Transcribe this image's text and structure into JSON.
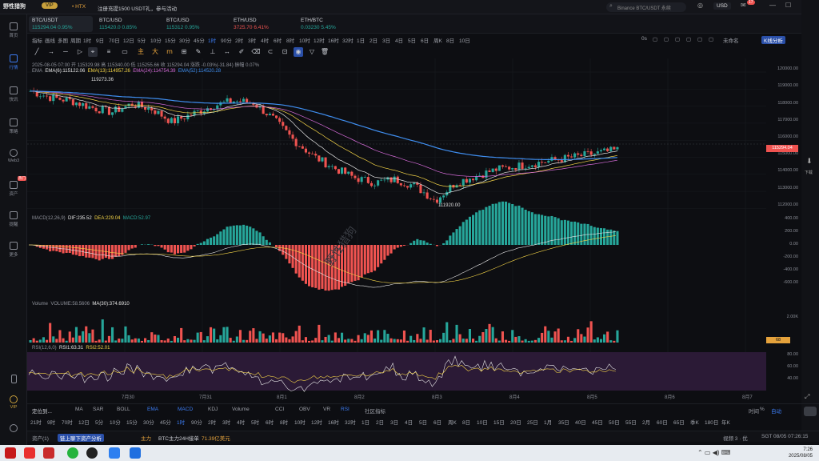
{
  "app": {
    "logo_text": "野性猎狗",
    "vip": "VIP",
    "exchange_tag": "• HTX",
    "promo": "注册充提1500 USDT礼，参与活动",
    "search_placeholder": "Binance BTC/USDT 永续",
    "currency": "USD",
    "notif_count": "17"
  },
  "sidebar": {
    "items": [
      {
        "label": "首页"
      },
      {
        "label": "行情"
      },
      {
        "label": "快讯"
      },
      {
        "label": "策略"
      },
      {
        "label": "Web3"
      },
      {
        "label": "资产"
      },
      {
        "label": "提醒"
      },
      {
        "label": "更多"
      }
    ],
    "bottom_vip": "VIP",
    "badge": "热门"
  },
  "tickers": [
    {
      "name": "BTC/USDT",
      "price": "115294.04",
      "change": "0.95%",
      "dir": "up"
    },
    {
      "name": "BTC/USD",
      "price": "115420.0",
      "change": "0.85%",
      "dir": "up"
    },
    {
      "name": "BTC/USD",
      "price": "115312",
      "change": "0.95%",
      "dir": "up"
    },
    {
      "name": "ETH/USD",
      "price": "3725.70",
      "change": "6.41%",
      "dir": "dn"
    },
    {
      "name": "ETH/BTC",
      "price": "0.03230",
      "change": "5.45%",
      "dir": "up"
    }
  ],
  "intervals": [
    "指标",
    "画线",
    "多图",
    "周期",
    "1时",
    "9日",
    "70日",
    "12日",
    "5分",
    "10分",
    "15分",
    "30分",
    "45分",
    "1时",
    "90分",
    "2时",
    "3时",
    "4时",
    "6时",
    "8时",
    "10时",
    "12时",
    "16时",
    "32时",
    "1日",
    "2日",
    "3日",
    "4日",
    "5日",
    "6日",
    "周K",
    "8日",
    "10日"
  ],
  "interval_right": [
    "0s",
    "未命名",
    "K线分析"
  ],
  "ohlc_line": "2025-08-05 07:00  开 115329.98  高 115340.00  低 115255.66  收 115294.04  涨跌 -0.03%(-31.84)  振幅 0.07%",
  "ema_line": {
    "label": "EMA",
    "ema6": "EMA(6):115122.06",
    "ema13": "EMA(13):114957.26",
    "ema24": "EMA(24):114754.39",
    "ema52": "EMA(52):114520.28"
  },
  "macd_line": {
    "label": "MACD(12,26,9)",
    "dif": "DIF:235.52",
    "dea": "DEA:229.04",
    "macd": "MACD:52.97"
  },
  "volume_line": {
    "label": "Volume",
    "vol": "VOLUME:58.5606",
    "ma": "MA(30):374.6910"
  },
  "rsi_line": {
    "label": "RSI(12,6,0)",
    "rsi1": "RSI1:63.31",
    "rsi2": "RSI2:52.01"
  },
  "annotations": {
    "high": "119273.36",
    "low": "111920.00",
    "current": "115294.04"
  },
  "y_axis_price": [
    "120000.00",
    "119000.00",
    "118000.00",
    "117000.00",
    "116000.00",
    "115000.00",
    "114000.00",
    "113000.00",
    "112000.00"
  ],
  "y_axis_macd": [
    "400.00",
    "200.00",
    "0.00",
    "-200.00",
    "-400.00",
    "-600.00"
  ],
  "y_axis_volume": [
    "2.00K",
    "68"
  ],
  "y_axis_rsi": [
    "80.00",
    "60.00",
    "40.00"
  ],
  "x_axis": [
    "7月30",
    "7月31",
    "8月1",
    "8月2",
    "8月3",
    "8月4",
    "8月5",
    "8月6",
    "8月7"
  ],
  "indicator_tabs": [
    "定位到...",
    "MA",
    "SAR",
    "BOLL",
    "EMA",
    "MACD",
    "KDJ",
    "Volume",
    "CCI",
    "OBV",
    "VR",
    "RSI",
    "社区指标"
  ],
  "indicator_right": [
    "时间",
    "%",
    "自动"
  ],
  "timeframes": [
    "21时",
    "9时",
    "70时",
    "12日",
    "5分",
    "10分",
    "15分",
    "30分",
    "45分",
    "1时",
    "90分",
    "2时",
    "3时",
    "4时",
    "5时",
    "6时",
    "8时",
    "10时",
    "12时",
    "16时",
    "32时",
    "1日",
    "2日",
    "3日",
    "4日",
    "5日",
    "6日",
    "周K",
    "8日",
    "10日",
    "15日",
    "20日",
    "25日",
    "1月",
    "35日",
    "40日",
    "45日",
    "50日",
    "55日",
    "2月",
    "60日",
    "65日",
    "季K",
    "180日",
    "年K"
  ],
  "status": {
    "left": "资产(1)",
    "link": "链上聊下资产分析",
    "main_label": "主力",
    "main_text": "BTC主力24H接单",
    "main_value": "71.39亿美元",
    "right_text": "视频 3 · 优",
    "time": "SGT 08/05 07:26:15"
  },
  "taskbar": {
    "time": "7:26",
    "date": "2025/08/05"
  },
  "chart_data": {
    "type": "candlestick",
    "x": [
      "7月30",
      "7月31",
      "8月1",
      "8月2",
      "8月3",
      "8月4",
      "8月5"
    ],
    "price_keypoints": [
      118900,
      118500,
      118300,
      117900,
      117600,
      118100,
      117800,
      117000,
      117500,
      118000,
      118300,
      118200,
      117200,
      115900,
      114900,
      114200,
      113600,
      113300,
      113500,
      113100,
      112200,
      113300,
      113700,
      114100,
      114300,
      114500,
      114700,
      114900,
      115100,
      115294
    ],
    "ylim": [
      111500,
      120500
    ],
    "colors": {
      "up": "#26a69a",
      "down": "#ef5350",
      "ema6": "#e6e6e6",
      "ema13": "#f5d547",
      "ema24": "#d46ad7",
      "ema52": "#3f8ef0"
    }
  }
}
